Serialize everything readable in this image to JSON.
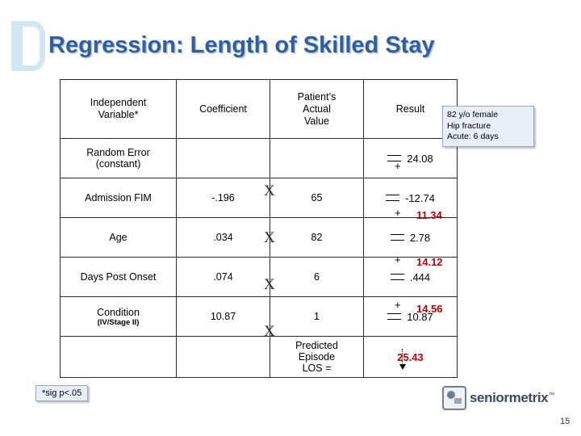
{
  "slide": {
    "title": "Regression: Length of Skilled Stay",
    "page_number": "15",
    "sig_note": "*sig p<.05"
  },
  "callout": {
    "line1": "82 y/o female",
    "line2": "Hip fracture",
    "line3": "Acute: 6 days"
  },
  "table": {
    "headers": [
      "Independent Variable*",
      "Coefficient",
      "Patient’s Actual Value",
      "Result"
    ],
    "header_lines": {
      "h1": [
        "Independent",
        "Variable*"
      ],
      "h2": [
        "Coefficient"
      ],
      "h3": [
        "Patient’s",
        "Actual",
        "Value"
      ],
      "h4": [
        "Result"
      ]
    },
    "rows": [
      {
        "variable": "Random Error",
        "variable_sub": "(constant)",
        "coefficient": "",
        "patient_value": "",
        "equals": "=",
        "result": "24.08",
        "times": "",
        "plus": "+"
      },
      {
        "variable": "Admission FIM",
        "variable_sub": "",
        "coefficient": "-.196",
        "patient_value": "65",
        "equals": "=",
        "result": "-12.74",
        "times": "X",
        "plus": "+"
      },
      {
        "variable": "Age",
        "variable_sub": "",
        "coefficient": ".034",
        "patient_value": "82",
        "equals": "=",
        "result": "2.78",
        "times": "X",
        "plus": "+"
      },
      {
        "variable": "Days Post Onset",
        "variable_sub": "",
        "coefficient": ".074",
        "patient_value": "6",
        "equals": "=",
        "result": ".444",
        "times": "X",
        "plus": "+"
      },
      {
        "variable": "Condition",
        "variable_sub": "(IV/Stage II)",
        "coefficient": "10.87",
        "patient_value": "1",
        "equals": "=",
        "result": "10.87",
        "times": "X",
        "plus": ""
      }
    ],
    "running_totals": [
      "11.34",
      "14.12",
      "14.56"
    ],
    "footer": {
      "label": "Predicted Episode LOS =",
      "label_lines": [
        "Predicted",
        "Episode",
        "LOS ="
      ],
      "value": "25.43"
    }
  },
  "brand": {
    "name": "seniormetrix",
    "tm": "™"
  }
}
